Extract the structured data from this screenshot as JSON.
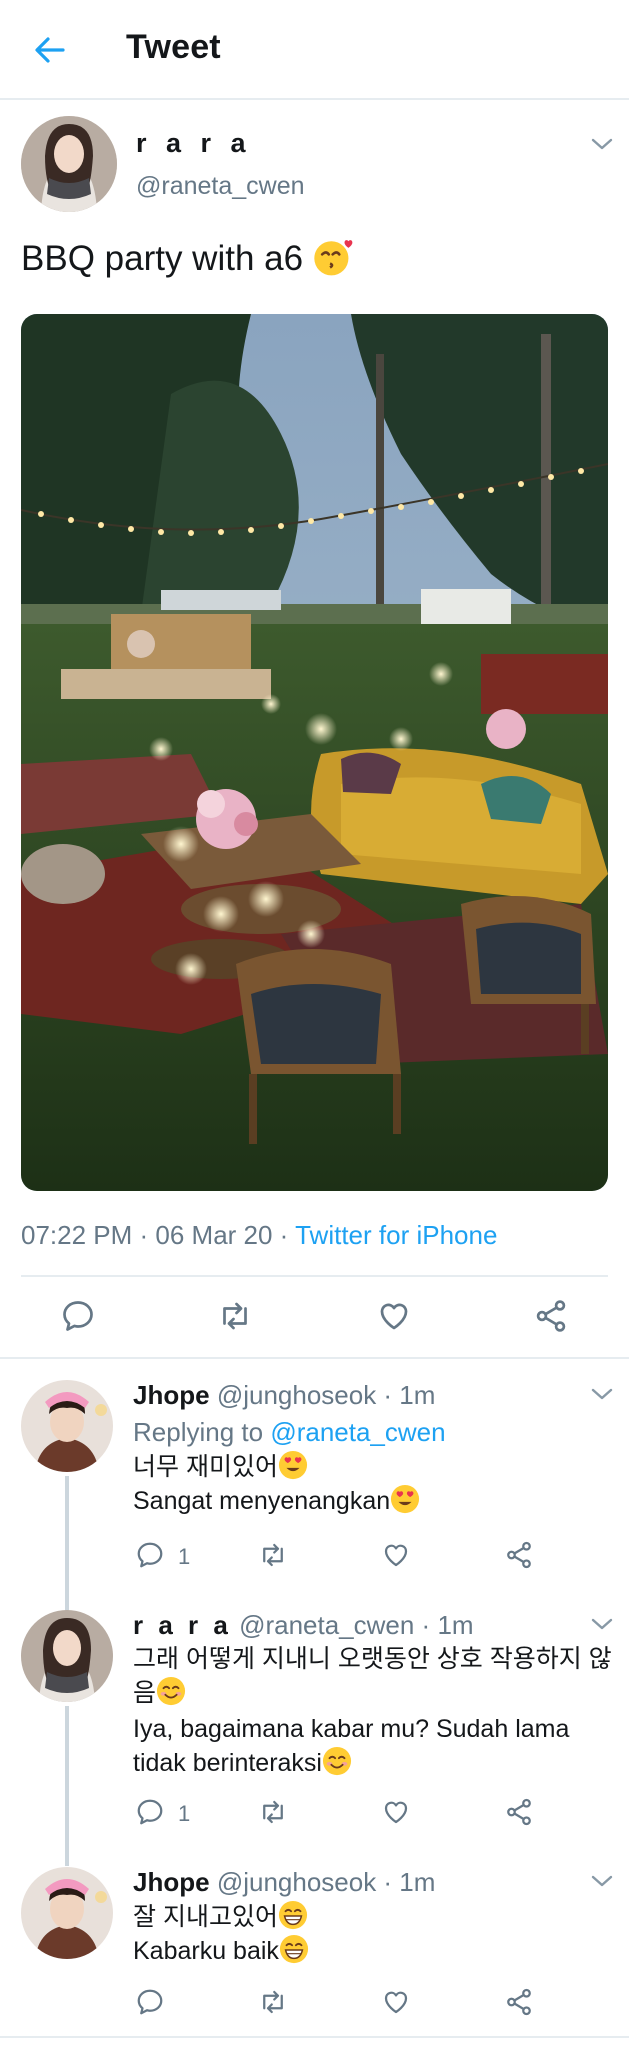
{
  "header": {
    "title": "Tweet"
  },
  "main_tweet": {
    "display_name": "r a r a",
    "handle": "@raneta_cwen",
    "text": "BBQ party with a6",
    "timestamp": "07:22 PM · 06 Mar 20 · ",
    "source": "Twitter for iPhone"
  },
  "replies": [
    {
      "name": "Jhope",
      "handle_time": "@junghoseok · 1m",
      "replying_prefix": "Replying to ",
      "replying_to": "@raneta_cwen",
      "line1": "너무 재미있어",
      "line2": "Sangat menyenangkan",
      "reply_count": "1"
    },
    {
      "name": "r a r a",
      "handle_time": "@raneta_cwen · 1m",
      "line1": "그래 어떻게 지내니  오랫동안 상호 작용하지 않음",
      "line2": "Iya, bagaimana kabar mu? Sudah lama tidak berinteraksi",
      "reply_count": "1"
    },
    {
      "name": "Jhope",
      "handle_time": "@junghoseok · 1m",
      "line1": "잘 지내고있어",
      "line2": "Kabarku baik"
    }
  ],
  "colors": {
    "accent": "#1da1f2",
    "muted": "#657786",
    "divider": "#e6ecf0"
  },
  "icons": [
    "back-arrow-icon",
    "chevron-down-icon",
    "reply-icon",
    "retweet-icon",
    "like-icon",
    "share-icon"
  ]
}
